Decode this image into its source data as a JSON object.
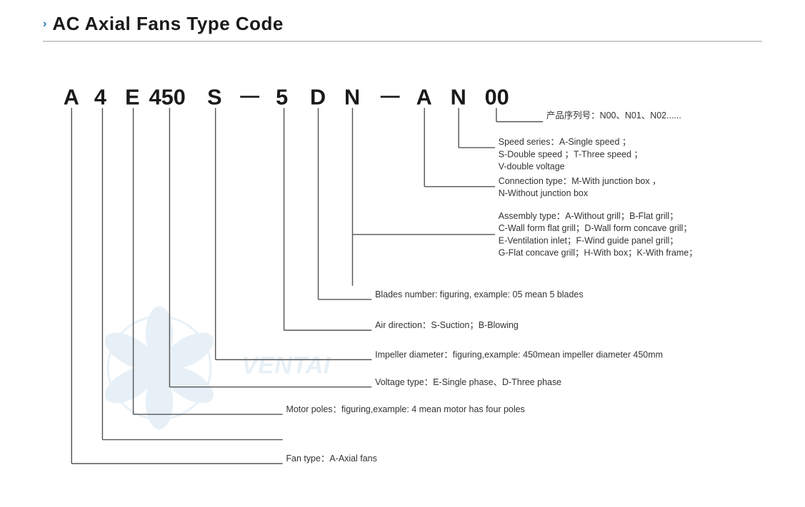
{
  "header": {
    "chevron": "›",
    "title": "AC Axial Fans Type Code"
  },
  "code_letters": [
    "A",
    "4",
    "E",
    "450",
    "S",
    "—",
    "5",
    "D",
    "N",
    "—",
    "A",
    "N",
    "00"
  ],
  "descriptions": {
    "product_series": {
      "label": "产品序列号：N00、N01、N02......"
    },
    "speed_series": {
      "line1": "Speed series：A-Single speed ；",
      "line2": "S-Double speed ；T-Three speed ；",
      "line3": "V-double voltage"
    },
    "connection_type": {
      "line1": "Connection type：M-With junction box ，",
      "line2": "N-Without junction box"
    },
    "assembly_type": {
      "line1": "Assembly type：A-Without grill；B-Flat grill；",
      "line2": "C-Wall form flat grill；D-Wall form concave grill；",
      "line3": "E-Ventilation inlet；F-Wind guide panel grill；",
      "line4": "G-Flat concave grill；H-With box；K-With frame；"
    },
    "blades_number": {
      "line1": "Blades number: figuring, example: 05 mean 5 blades"
    },
    "air_direction": {
      "line1": "Air direction：S-Suction；B-Blowing"
    },
    "impeller_diameter": {
      "line1": "Impeller diameter：figuring,example: 450mean impeller diameter 450mm"
    },
    "voltage_type": {
      "line1": "Voltage type：E-Single phase、D-Three phase"
    },
    "motor_poles": {
      "line1": "Motor poles：figuring,example: 4 mean motor has four poles"
    },
    "fan_type": {
      "line1": "Fan type：A-Axial fans"
    }
  }
}
